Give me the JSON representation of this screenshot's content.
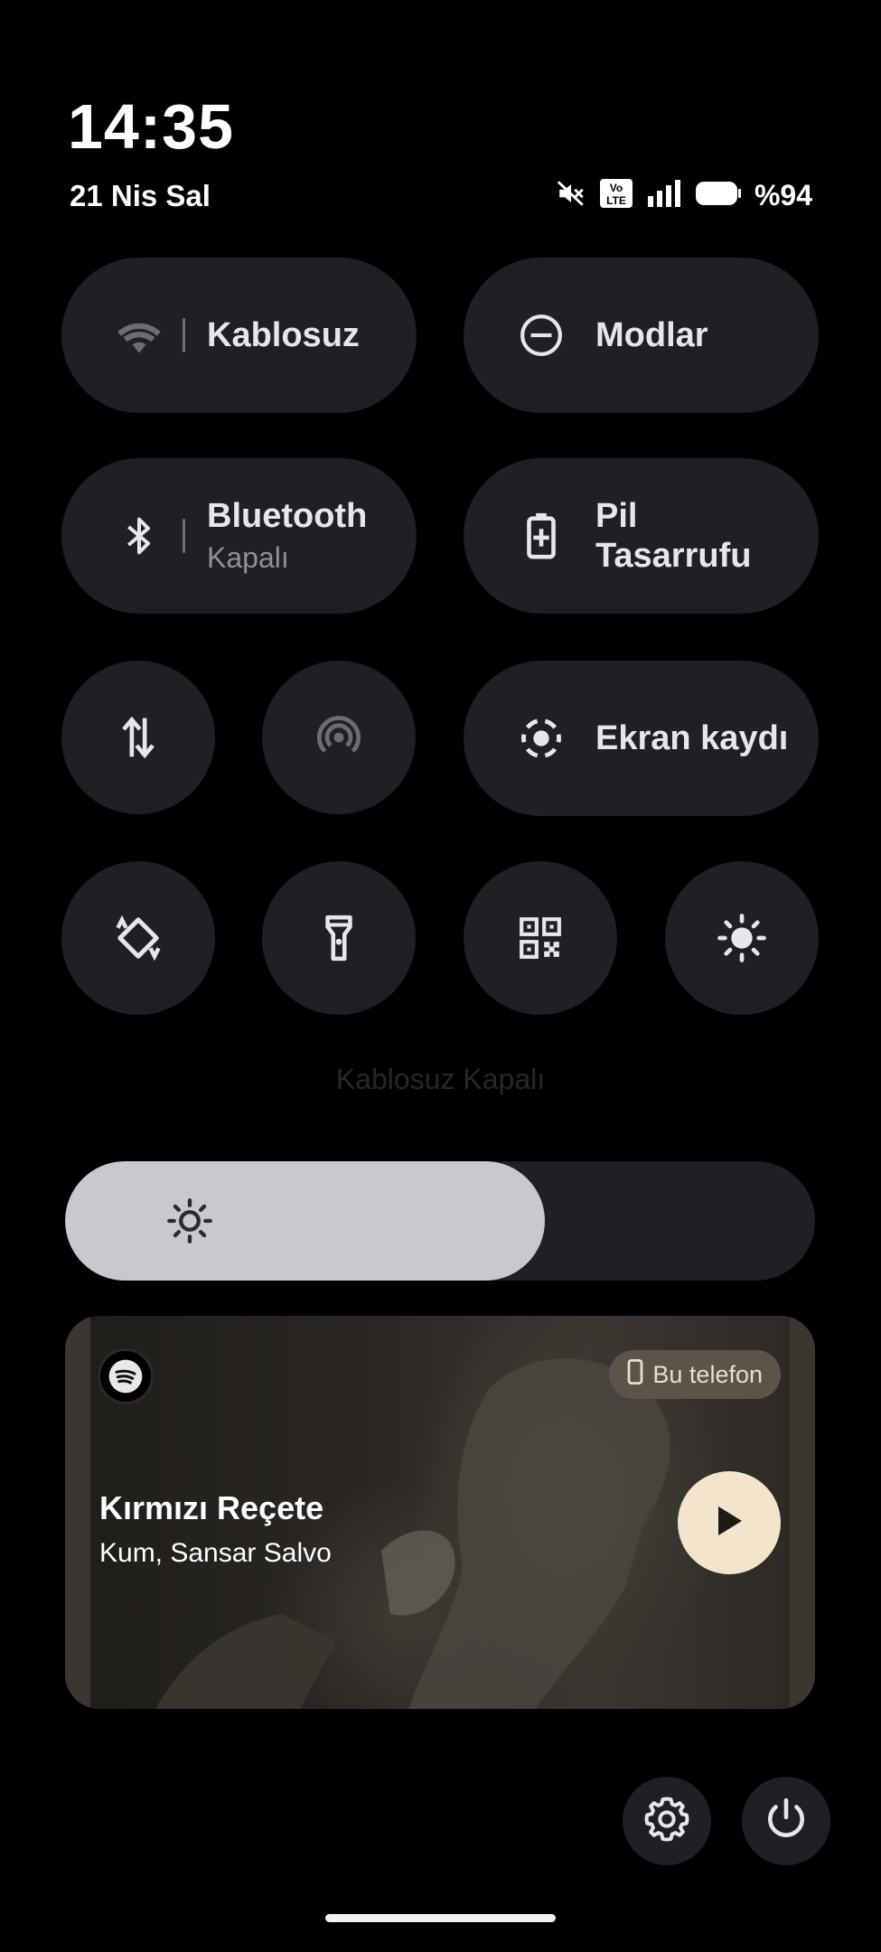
{
  "status_bar": {
    "time": "14:35",
    "date": "21 Nis Sal",
    "volte_text": "Vo LTE",
    "battery": "%94",
    "icons": [
      "mute-icon",
      "volte-icon",
      "signal-icon",
      "battery-icon"
    ]
  },
  "tiles": {
    "wifi": {
      "label": "Kablosuz",
      "icon": "wifi-icon"
    },
    "modes": {
      "label": "Modlar",
      "icon": "do-not-disturb-icon"
    },
    "bluetooth": {
      "label": "Bluetooth",
      "sublabel": "Kapalı",
      "icon": "bluetooth-icon"
    },
    "battery_saver": {
      "label_line1": "Pil",
      "label_line2": "Tasarrufu",
      "icon": "battery-plus-icon"
    },
    "mobile_data": {
      "icon": "data-arrows-icon"
    },
    "hotspot": {
      "icon": "hotspot-icon"
    },
    "screen_record": {
      "label": "Ekran kaydı",
      "icon": "screen-record-icon"
    },
    "auto_rotate": {
      "icon": "rotate-icon"
    },
    "flashlight": {
      "icon": "flashlight-icon"
    },
    "qr_scanner": {
      "icon": "qr-code-icon"
    },
    "brightness_mode": {
      "icon": "brightness-icon"
    }
  },
  "tip_text": "Kablosuz Kapalı",
  "brightness_slider": {
    "level": 0.64,
    "icon": "sun-icon"
  },
  "media": {
    "app_icon": "spotify-icon",
    "device_label": "Bu telefon",
    "device_icon": "phone-icon",
    "title": "Kırmızı Reçete",
    "artist": "Kum, Sansar Salvo",
    "play_icon": "play-icon",
    "colors": {
      "play_bg": "#f3e4cc",
      "chip_bg": "#5b5447"
    }
  },
  "bottom_buttons": {
    "settings_icon": "gear-icon",
    "power_icon": "power-icon"
  },
  "colors": {
    "background": "#000000",
    "tile_bg": "#1f2023",
    "slider_fill": "#c8c9ce"
  }
}
